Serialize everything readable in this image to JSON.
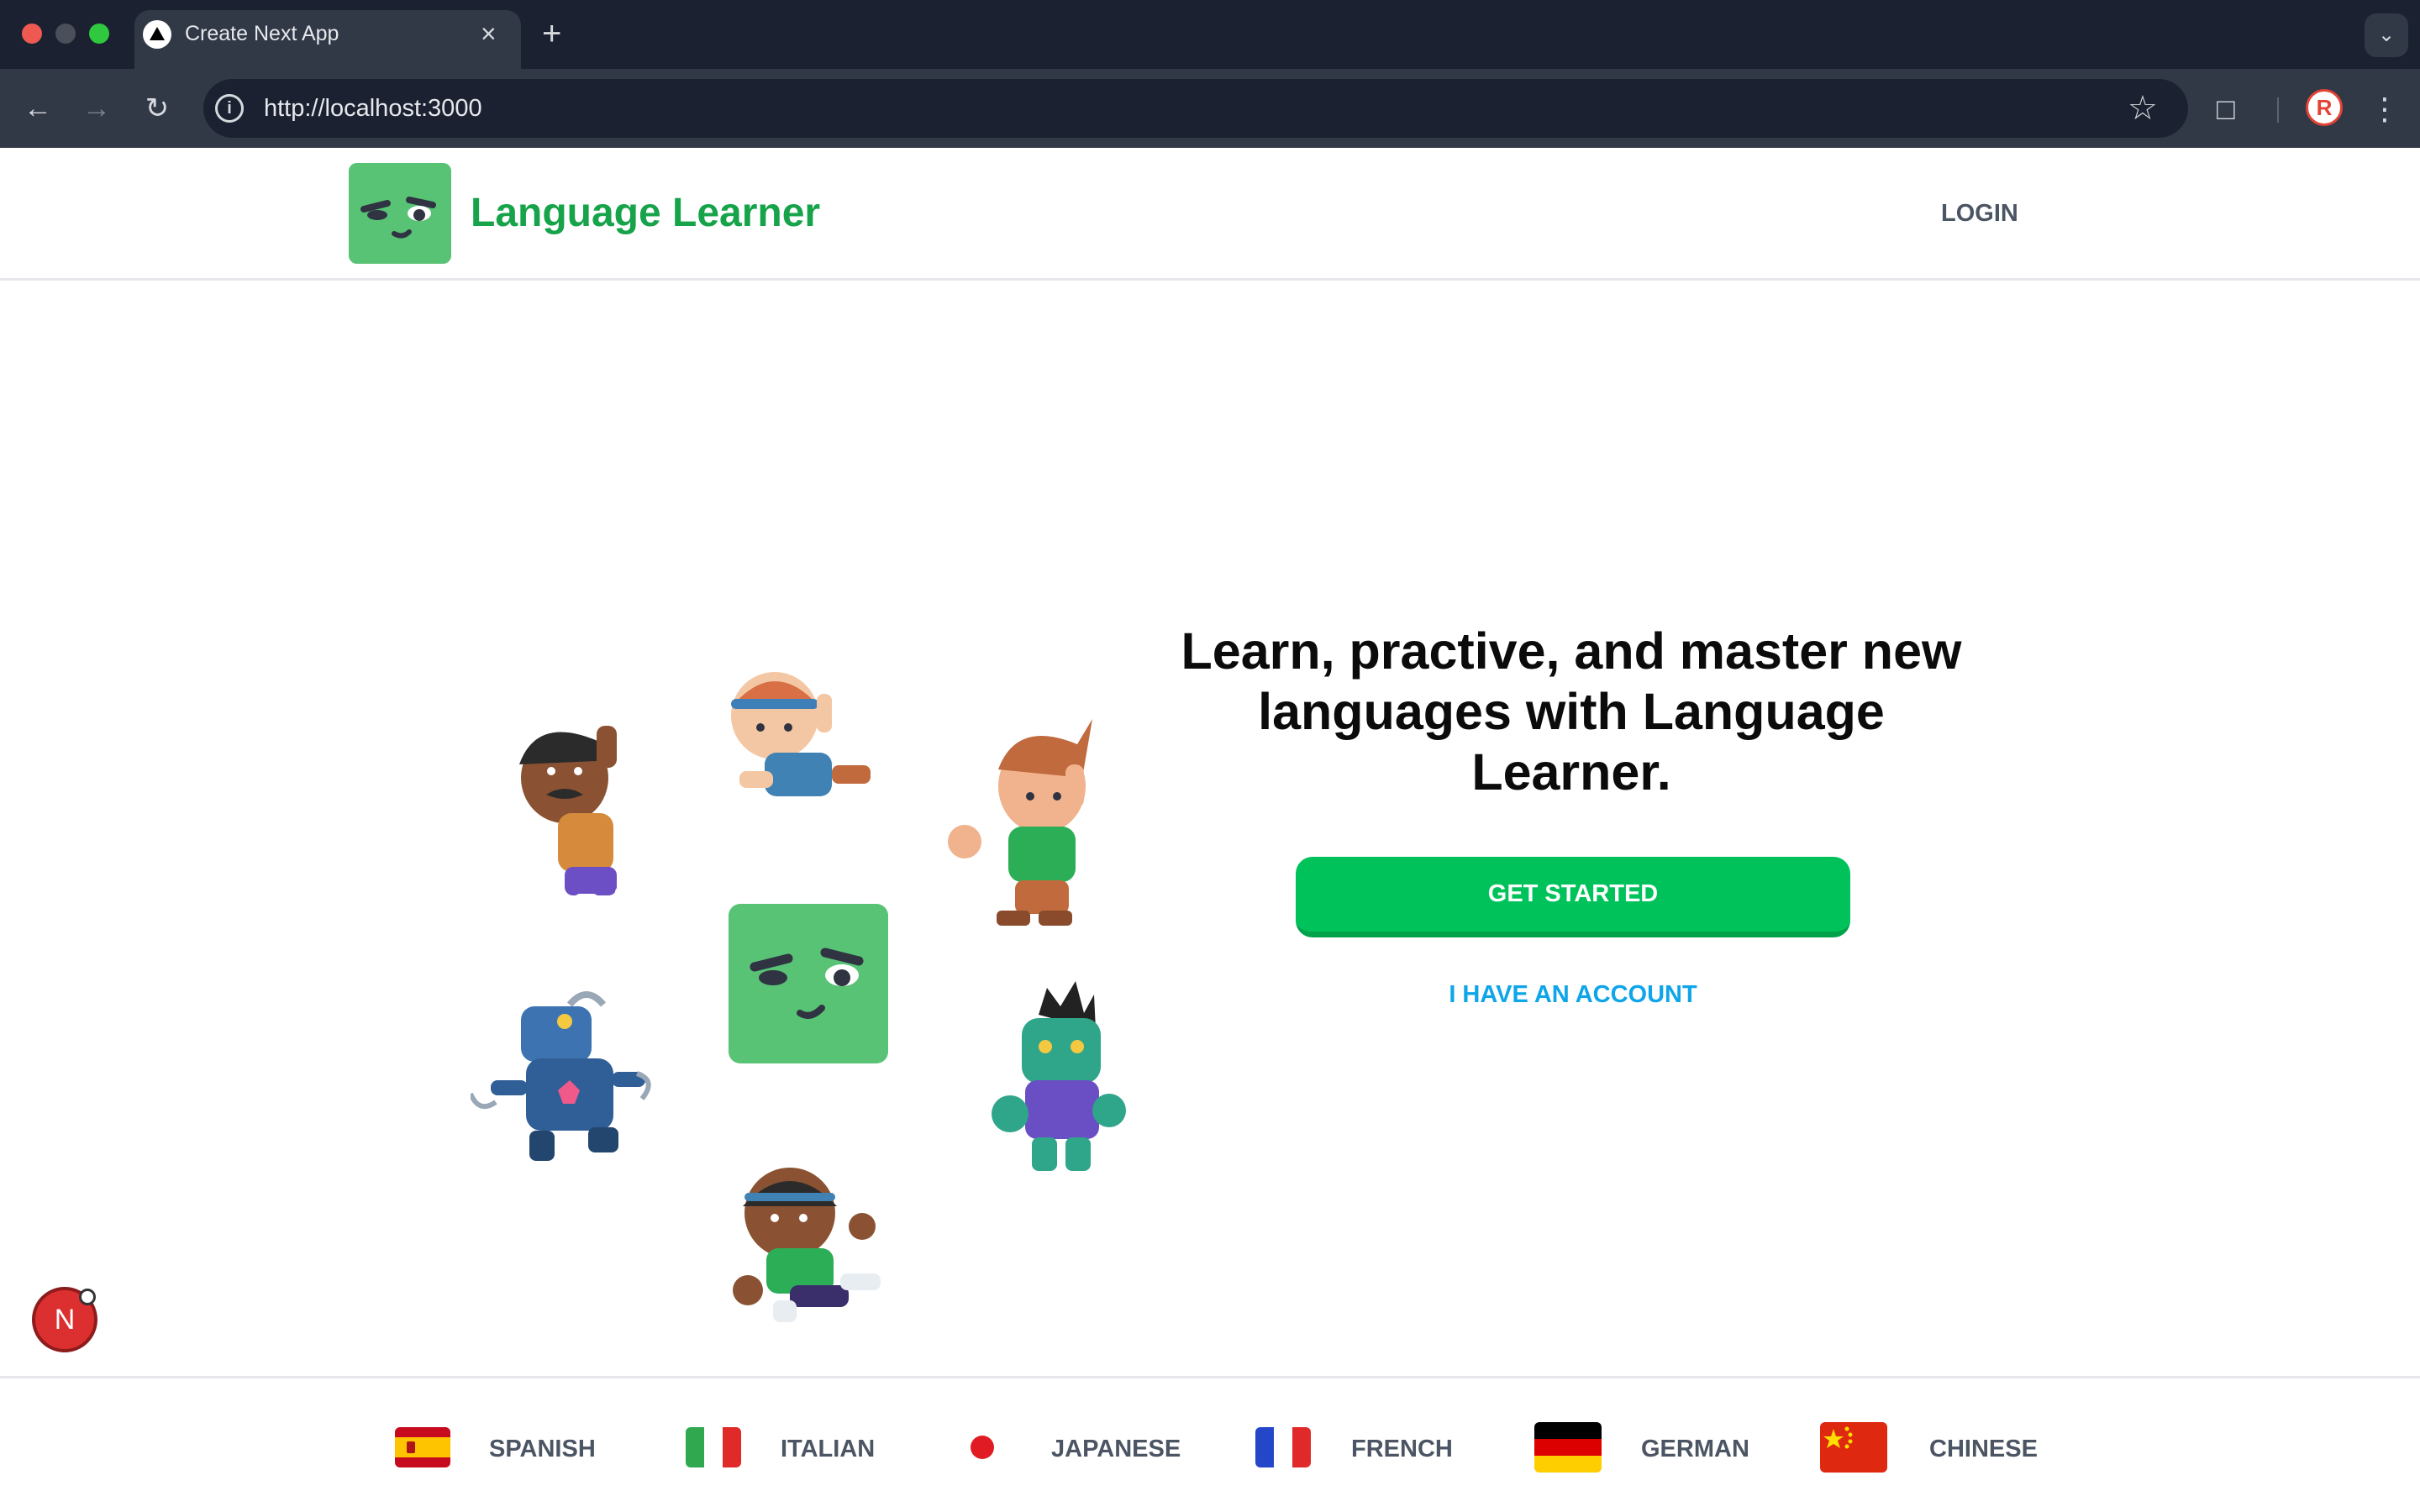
{
  "browser": {
    "tab_title": "Create Next App",
    "tab_close_glyph": "×",
    "new_tab_glyph": "+",
    "url": "http://localhost:3000",
    "icons": [
      "nextjs-favicon",
      "back-arrow-icon",
      "forward-arrow-icon",
      "reload-icon",
      "site-info-icon",
      "bookmark-star-icon",
      "extensions-icon",
      "profile-avatar-icon",
      "kebab-menu-icon",
      "tab-search-chevron-icon"
    ],
    "profile_initial": "R"
  },
  "header": {
    "brand": "Language Learner",
    "login_label": "LOGIN"
  },
  "hero": {
    "headline": "Learn, practive, and master new languages with Language Learner.",
    "primary_cta": "GET STARTED",
    "secondary_cta": "I HAVE AN ACCOUNT",
    "characters": [
      "mascot-box",
      "girl-headband",
      "boy-green-shirt",
      "man-mustache",
      "robot",
      "zombie",
      "girl-green-shirt"
    ]
  },
  "footer": {
    "languages": [
      {
        "label": "SPANISH",
        "flag": "spain-flag"
      },
      {
        "label": "ITALIAN",
        "flag": "italy-flag"
      },
      {
        "label": "JAPANESE",
        "flag": "japan-flag"
      },
      {
        "label": "FRENCH",
        "flag": "france-flag"
      },
      {
        "label": "GERMAN",
        "flag": "germany-flag"
      },
      {
        "label": "CHINESE",
        "flag": "china-flag"
      }
    ]
  },
  "dev_badge": {
    "label": "N"
  },
  "colors": {
    "brand_green": "#16a34a",
    "mascot_green": "#58c275",
    "cta_green": "#00c25a",
    "link_blue": "#0ea5e9",
    "chrome_dark": "#1b2130",
    "chrome_toolbar": "#313846"
  }
}
